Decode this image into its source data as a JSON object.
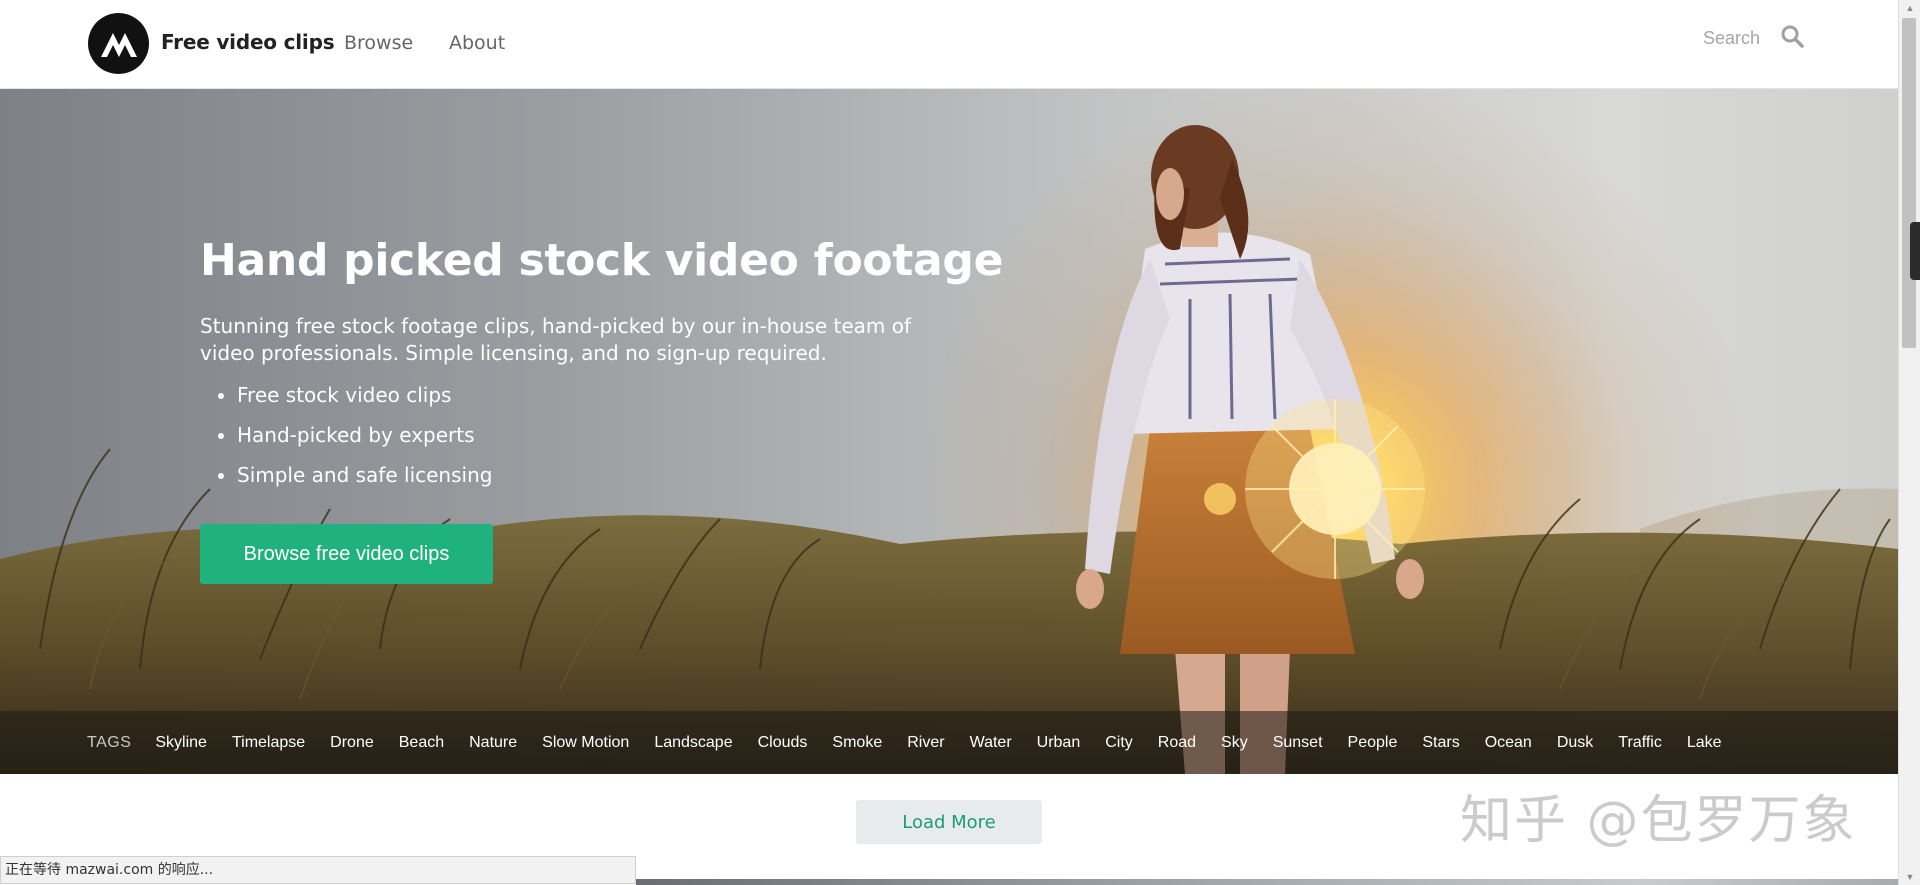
{
  "header": {
    "brand": "Free video clips",
    "nav": [
      {
        "label": "Browse"
      },
      {
        "label": "About"
      }
    ],
    "search_placeholder": "Search"
  },
  "hero": {
    "title": "Hand picked stock video footage",
    "subtitle": "Stunning free stock footage clips, hand-picked by our in-house team of video professionals. Simple licensing, and no sign-up required.",
    "bullets": [
      "Free stock video clips",
      "Hand-picked by experts",
      "Simple and safe licensing"
    ],
    "cta_label": "Browse free video clips"
  },
  "tags": {
    "label": "TAGS",
    "items": [
      "Skyline",
      "Timelapse",
      "Drone",
      "Beach",
      "Nature",
      "Slow Motion",
      "Landscape",
      "Clouds",
      "Smoke",
      "River",
      "Water",
      "Urban",
      "City",
      "Road",
      "Sky",
      "Sunset",
      "People",
      "Stars",
      "Ocean",
      "Dusk",
      "Traffic",
      "Lake"
    ]
  },
  "load_more_label": "Load More",
  "watermark": "知乎 @包罗万象",
  "status_text": "正在等待 mazwai.com 的响应...",
  "colors": {
    "accent": "#20b27e",
    "load_more_text": "#1a9e6e",
    "logo_bg": "#111111"
  }
}
